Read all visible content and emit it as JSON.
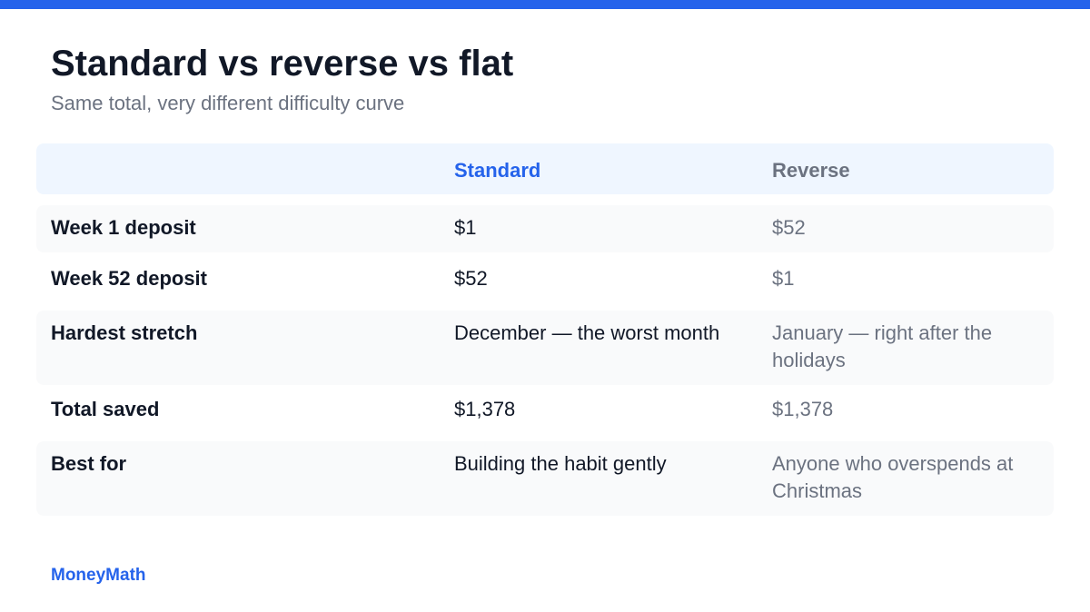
{
  "header": {
    "title": "Standard vs reverse vs flat",
    "subtitle": "Same total, very different difficulty curve"
  },
  "table": {
    "columns": [
      "",
      "Standard",
      "Reverse"
    ],
    "rows": [
      {
        "label": "Week 1 deposit",
        "standard": "$1",
        "reverse": "$52"
      },
      {
        "label": "Week 52 deposit",
        "standard": "$52",
        "reverse": "$1"
      },
      {
        "label": "Hardest stretch",
        "standard": "December — the worst month",
        "reverse": "January — right after the holidays"
      },
      {
        "label": "Total saved",
        "standard": "$1,378",
        "reverse": "$1,378"
      },
      {
        "label": "Best for",
        "standard": "Building the habit gently",
        "reverse": "Anyone who overspends at Christmas"
      }
    ]
  },
  "footer": {
    "brand": "MoneyMath"
  },
  "colors": {
    "accent": "#2563eb",
    "header_bg": "#eff6ff",
    "row_shade": "#f9fafb",
    "text_dark": "#111827",
    "text_muted": "#6b7280"
  }
}
